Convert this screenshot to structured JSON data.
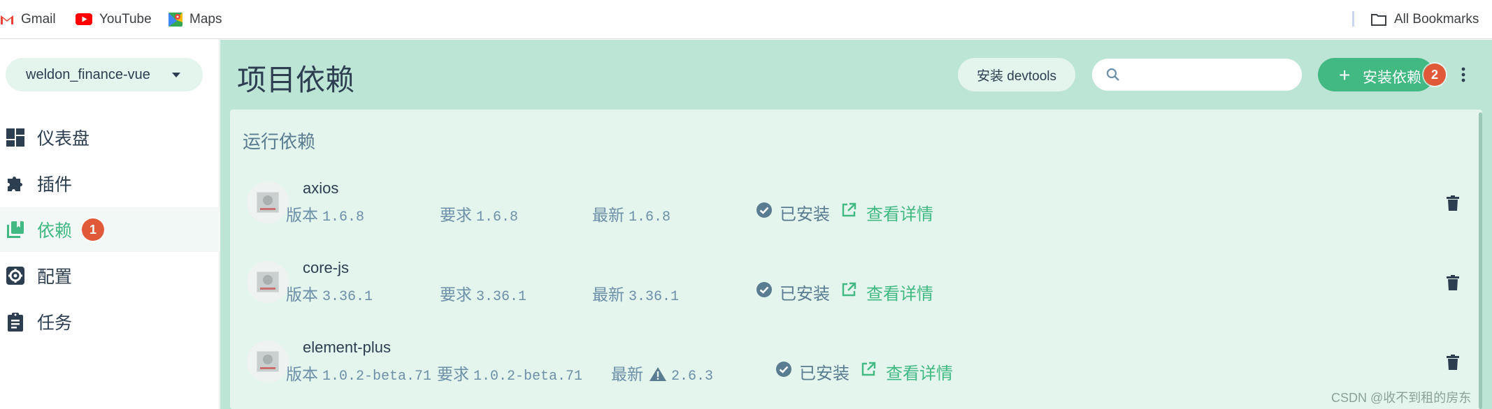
{
  "bookmarks": {
    "items": [
      {
        "label": "Gmail",
        "icon": "gmail-icon"
      },
      {
        "label": "YouTube",
        "icon": "youtube-icon"
      },
      {
        "label": "Maps",
        "icon": "maps-icon"
      }
    ],
    "all_label": "All Bookmarks",
    "all_icon": "folder-icon"
  },
  "sidebar": {
    "project": "weldon_finance-vue",
    "items": [
      {
        "label": "仪表盘",
        "icon": "dashboard-icon",
        "active": false
      },
      {
        "label": "插件",
        "icon": "puzzle-icon",
        "active": false
      },
      {
        "label": "依赖",
        "icon": "library-icon",
        "active": true,
        "badge": "1"
      },
      {
        "label": "配置",
        "icon": "settings-icon",
        "active": false
      },
      {
        "label": "任务",
        "icon": "clipboard-icon",
        "active": false
      }
    ]
  },
  "header": {
    "title": "项目依赖",
    "devtools_label": "安装 devtools",
    "search_placeholder": "",
    "install_label": "安装依赖",
    "install_badge": "2"
  },
  "section": {
    "title": "运行依赖"
  },
  "dependencies": [
    {
      "name": "axios",
      "version_label": "版本",
      "version": "1.6.8",
      "wanted_label": "要求",
      "wanted": "1.6.8",
      "latest_label": "最新",
      "latest": "1.6.8",
      "latest_warning": false,
      "status": "已安装",
      "detail": "查看详情"
    },
    {
      "name": "core-js",
      "version_label": "版本",
      "version": "3.36.1",
      "wanted_label": "要求",
      "wanted": "3.36.1",
      "latest_label": "最新",
      "latest": "3.36.1",
      "latest_warning": false,
      "status": "已安装",
      "detail": "查看详情"
    },
    {
      "name": "element-plus",
      "version_label": "版本",
      "version": "1.0.2-beta.71",
      "wanted_label": "要求",
      "wanted": "1.0.2-beta.71",
      "latest_label": "最新",
      "latest": "2.6.3",
      "latest_warning": true,
      "status": "已安装",
      "detail": "查看详情"
    }
  ],
  "watermark": "CSDN @收不到租的房东",
  "colors": {
    "accent": "#42b983",
    "main_bg": "#bde5d6",
    "panel_bg": "#e3f5ec",
    "badge": "#e05a3a",
    "muted_text": "#6d8fa8"
  }
}
